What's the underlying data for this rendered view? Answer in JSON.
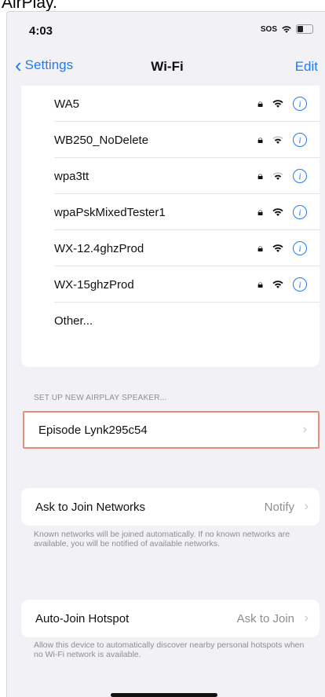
{
  "caption": "AirPlay.",
  "status_bar": {
    "time": "4:03",
    "signal": "SOS"
  },
  "nav": {
    "back_label": "Settings",
    "title": "Wi-Fi",
    "edit_label": "Edit"
  },
  "networks": [
    {
      "name": "WA5",
      "secured": true,
      "signal": "strong"
    },
    {
      "name": "WB250_NoDelete",
      "secured": true,
      "signal": "weak"
    },
    {
      "name": "wpa3tt",
      "secured": true,
      "signal": "weak"
    },
    {
      "name": "wpaPskMixedTester1",
      "secured": true,
      "signal": "strong"
    },
    {
      "name": "WX-12.4ghzProd",
      "secured": true,
      "signal": "strong"
    },
    {
      "name": "WX-15ghzProd",
      "secured": true,
      "signal": "strong"
    }
  ],
  "other_label": "Other...",
  "airplay": {
    "section_header": "SET UP NEW AIRPLAY SPEAKER...",
    "speaker_name": "Episode Lynk295c54"
  },
  "ask_to_join": {
    "label": "Ask to Join Networks",
    "value": "Notify",
    "footer": "Known networks will be joined automatically. If no known networks are available, you will be notified of available networks."
  },
  "auto_join_hotspot": {
    "label": "Auto-Join Hotspot",
    "value": "Ask to Join",
    "footer": "Allow this device to automatically discover nearby personal hotspots when no Wi-Fi network is available."
  },
  "colors": {
    "accent": "#1f7cf6",
    "highlight_border": "#e2907b",
    "background": "#f2f2f6"
  }
}
